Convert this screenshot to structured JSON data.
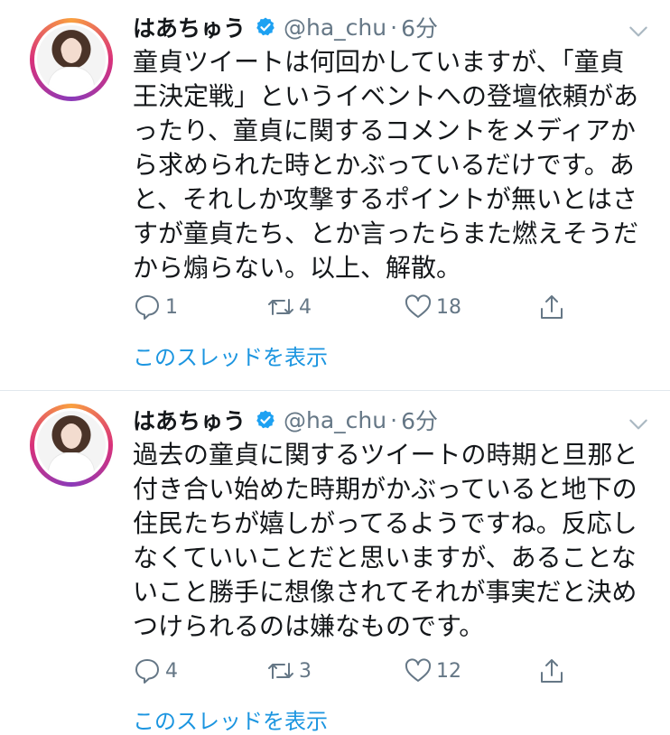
{
  "tweets": [
    {
      "display_name": "はあちゅう",
      "handle": "@ha_chu",
      "separator": "·",
      "time": "6分",
      "body_lines": [
        "童貞ツイートは何回かしていますが、「童貞",
        "王決定戦」というイベントへの登壇依頼があ",
        "ったり、童貞に関するコメントをメディアか",
        "ら求められた時とかぶっているだけです。あ",
        "と、それしか攻撃するポイントが無いとはさ",
        "すが童貞たち、とか言ったらまた燃えそうだ",
        "から煽らない。以上、解散。"
      ],
      "reply_count": "1",
      "retweet_count": "4",
      "like_count": "18",
      "thread_link": "このスレッドを表示"
    },
    {
      "display_name": "はあちゅう",
      "handle": "@ha_chu",
      "separator": "·",
      "time": "6分",
      "body_lines": [
        "過去の童貞に関するツイートの時期と旦那と",
        "付き合い始めた時期がかぶっていると地下の",
        "住民たちが嬉しがってるようですね。反応し",
        "なくていいことだと思いますが、あることな",
        "いこと勝手に想像されてそれが事実だと決め",
        "つけられるのは嫌なものです。"
      ],
      "reply_count": "4",
      "retweet_count": "3",
      "like_count": "12",
      "thread_link": "このスレッドを表示"
    }
  ],
  "icons": {
    "verified": "verified-badge-icon",
    "menu": "chevron-down-icon",
    "reply": "reply-icon",
    "retweet": "retweet-icon",
    "like": "heart-icon",
    "share": "share-icon"
  },
  "colors": {
    "text": "#14171a",
    "secondary": "#657786",
    "link": "#1b95e0",
    "verified": "#1da1f2",
    "divider": "#e1e8ed"
  }
}
